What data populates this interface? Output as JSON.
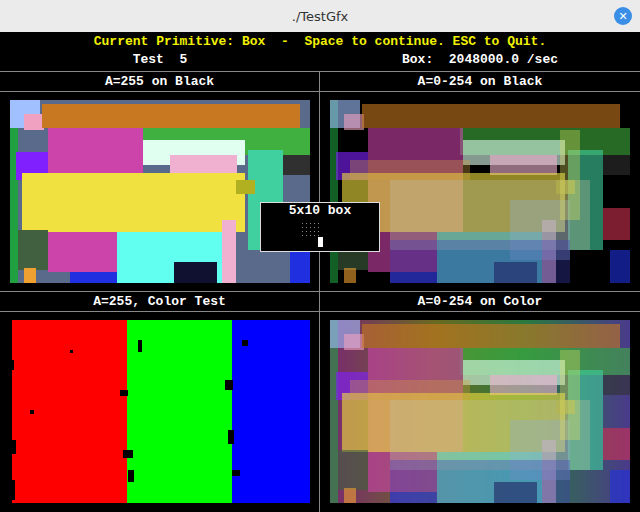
{
  "window": {
    "title": "./TestGfx",
    "close": "✕"
  },
  "status": {
    "primitive_line": "Current Primitive: Box  -  Space to continue. ESC to Quit.",
    "test": "Test  5",
    "rate": "Box:  2048000.0 /sec"
  },
  "panels": [
    {
      "label": "A=255 on Black",
      "kind": "opaque",
      "colors": []
    },
    {
      "label": "A=0-254 on Black",
      "kind": "alpha",
      "colors": []
    },
    {
      "label": "A=255, Color Test",
      "kind": "color-test",
      "colors": [
        "#ff0000",
        "#00ff00",
        "#0000ff"
      ]
    },
    {
      "label": "A=0-254 on Color",
      "kind": "alpha-on-color",
      "colors": []
    }
  ],
  "overlay": {
    "title": "5x10 box"
  }
}
